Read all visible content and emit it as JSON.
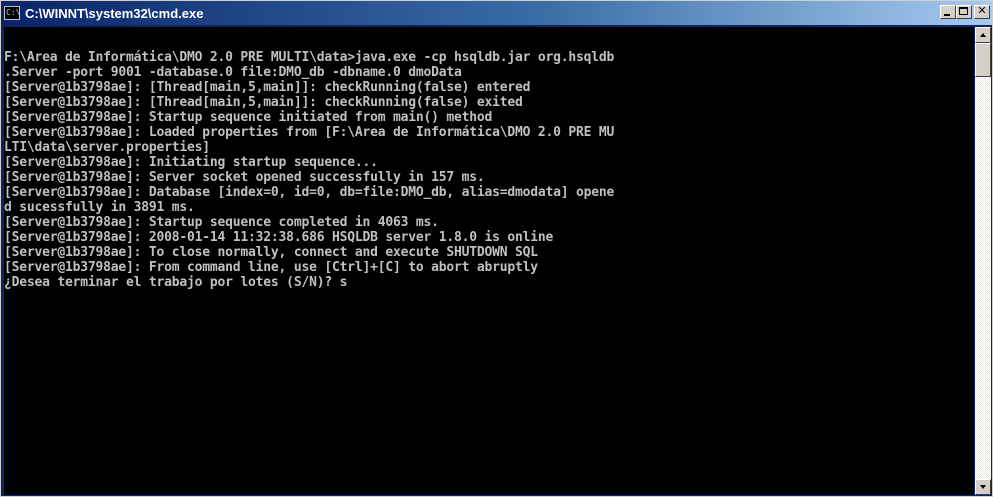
{
  "window": {
    "title": "C:\\WINNT\\system32\\cmd.exe",
    "icon_label": "C:\\"
  },
  "console": {
    "lines": [
      "F:\\Area de Informática\\DMO 2.0 PRE MULTI\\data>java.exe -cp hsqldb.jar org.hsqldb",
      ".Server -port 9001 -database.0 file:DMO_db -dbname.0 dmoData",
      "[Server@1b3798ae]: [Thread[main,5,main]]: checkRunning(false) entered",
      "[Server@1b3798ae]: [Thread[main,5,main]]: checkRunning(false) exited",
      "[Server@1b3798ae]: Startup sequence initiated from main() method",
      "[Server@1b3798ae]: Loaded properties from [F:\\Area de Informática\\DMO 2.0 PRE MU",
      "LTI\\data\\server.properties]",
      "[Server@1b3798ae]: Initiating startup sequence...",
      "[Server@1b3798ae]: Server socket opened successfully in 157 ms.",
      "[Server@1b3798ae]: Database [index=0, id=0, db=file:DMO_db, alias=dmodata] opene",
      "d sucessfully in 3891 ms.",
      "[Server@1b3798ae]: Startup sequence completed in 4063 ms.",
      "[Server@1b3798ae]: 2008-01-14 11:32:38.686 HSQLDB server 1.8.0 is online",
      "[Server@1b3798ae]: To close normally, connect and execute SHUTDOWN SQL",
      "[Server@1b3798ae]: From command line, use [Ctrl]+[C] to abort abruptly",
      "¿Desea terminar el trabajo por lotes (S/N)? s"
    ]
  },
  "colors": {
    "console_background": "#000000",
    "console_text": "#c0c0c0",
    "titlebar_start": "#0a246a",
    "titlebar_end": "#a6caf0",
    "title_text": "#ffffff"
  },
  "icons": {
    "app": "console-window-icon",
    "minimize": "minimize-icon",
    "maximize": "maximize-icon",
    "close": "close-icon",
    "scroll_up": "arrow-up-icon",
    "scroll_down": "arrow-down-icon"
  }
}
